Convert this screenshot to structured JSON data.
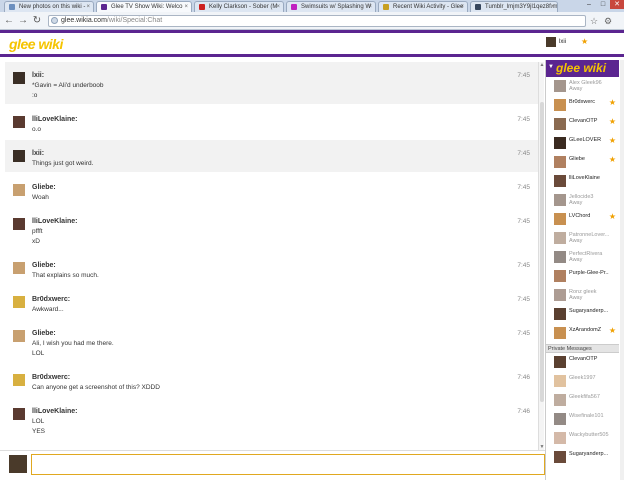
{
  "browser": {
    "tabs": [
      {
        "label": "New photos on this wiki -",
        "color": "#6b8fbf"
      },
      {
        "label": "Glee TV Show Wiki: Welco",
        "color": "#5b2590"
      },
      {
        "label": "Kelly Clarkson - Sober (M",
        "color": "#cc2020"
      },
      {
        "label": "Swimsuits w/ Splashing W",
        "color": "#c020c0"
      },
      {
        "label": "Recent Wiki Activity - Glee",
        "color": "#c8a020"
      },
      {
        "label": "Tumblr_lmjm3Y9jl1qez8f.m",
        "color": "#36465d"
      }
    ],
    "url_host": "glee.wikia.com",
    "url_path": "/wiki/Special:Chat"
  },
  "header": {
    "logo": "glee wiki",
    "current_user": "lxii"
  },
  "messages": [
    {
      "user": "lxii:",
      "time": "7:45",
      "lines": [
        "*Gavin = Ali'd underboob",
        ":o"
      ]
    },
    {
      "user": "lliLoveKlaine:",
      "time": "7:45",
      "lines": [
        "o.o"
      ]
    },
    {
      "user": "lxii:",
      "time": "7:45",
      "lines": [
        "Things just got weird."
      ]
    },
    {
      "user": "Gliebe:",
      "time": "7:45",
      "lines": [
        "Woah"
      ]
    },
    {
      "user": "lliLoveKlaine:",
      "time": "7:45",
      "lines": [
        "pffft",
        "xD"
      ]
    },
    {
      "user": "Gliebe:",
      "time": "7:45",
      "lines": [
        "That explains so much."
      ]
    },
    {
      "user": "Br0dxwerc:",
      "time": "7:45",
      "lines": [
        "Awkward..."
      ]
    },
    {
      "user": "Gliebe:",
      "time": "7:45",
      "lines": [
        "Ali, I wish you had me there.",
        "LOL"
      ]
    },
    {
      "user": "Br0dxwerc:",
      "time": "7:46",
      "lines": [
        "Can anyone get a screenshot of this? XDDD"
      ]
    },
    {
      "user": "lliLoveKlaine:",
      "time": "7:46",
      "lines": [
        "LOL",
        "YES"
      ]
    }
  ],
  "sidebar": {
    "wiki_label": "glee wiki",
    "users": [
      {
        "name": "Alex Gleek96",
        "status": "Away",
        "away": true,
        "star": false
      },
      {
        "name": "Br0dxwerc",
        "status": "",
        "away": false,
        "star": true
      },
      {
        "name": "ClevanOTP",
        "status": "",
        "away": false,
        "star": true
      },
      {
        "name": "GLeeLOVER",
        "status": "",
        "away": false,
        "star": true
      },
      {
        "name": "Gliebe",
        "status": "",
        "away": false,
        "star": true
      },
      {
        "name": "lliLoveKlaine",
        "status": "",
        "away": false,
        "star": false
      },
      {
        "name": "Jellocide3",
        "status": "Away",
        "away": true,
        "star": false
      },
      {
        "name": "LVChord",
        "status": "",
        "away": false,
        "star": true
      },
      {
        "name": "PatronneLover...",
        "status": "Away",
        "away": true,
        "star": false
      },
      {
        "name": "PerfectRivera",
        "status": "Away",
        "away": true,
        "star": false
      },
      {
        "name": "Purple-Glee-Pr...",
        "status": "",
        "away": false,
        "star": false
      },
      {
        "name": "Ronz gleek",
        "status": "Away",
        "away": true,
        "star": false
      },
      {
        "name": "Sugaryanderp...",
        "status": "",
        "away": false,
        "star": false
      },
      {
        "name": "XzArandomZ",
        "status": "",
        "away": false,
        "star": true
      }
    ],
    "pm_header": "Private Messages",
    "pm_users": [
      {
        "name": "ClevanOTP",
        "away": false
      },
      {
        "name": "Gleek1997",
        "away": true
      },
      {
        "name": "Gleekfifa567",
        "away": true
      },
      {
        "name": "Wisefinale101",
        "away": true
      },
      {
        "name": "Wackybutter505",
        "away": true
      },
      {
        "name": "Sugaryanderp...",
        "away": false
      }
    ]
  },
  "input": {
    "placeholder": ""
  }
}
